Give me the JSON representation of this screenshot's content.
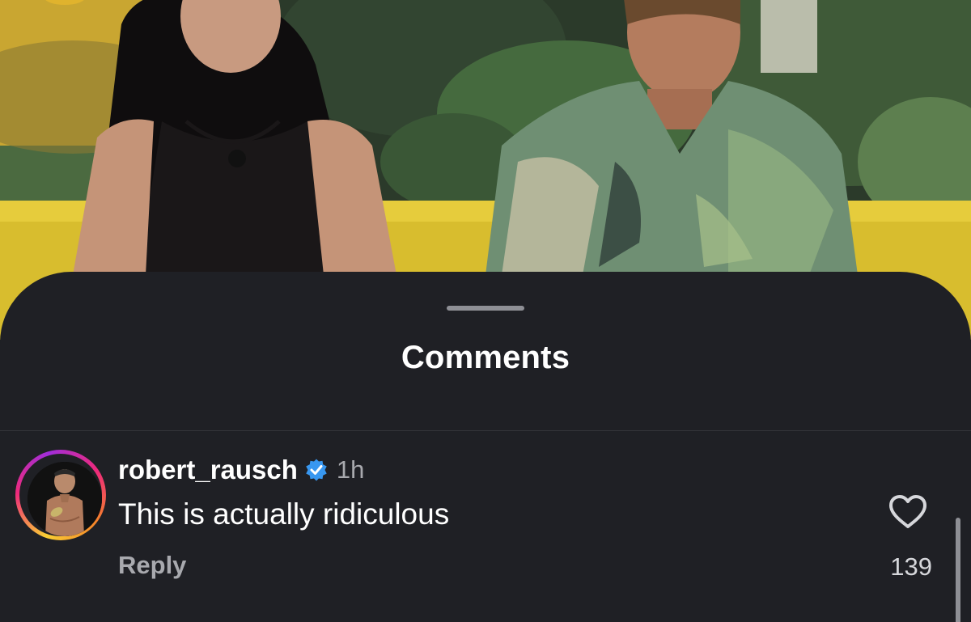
{
  "sheet": {
    "title": "Comments"
  },
  "comments": [
    {
      "username": "robert_rausch",
      "verified": true,
      "time": "1h",
      "text": "This is actually ridiculous",
      "reply_label": "Reply",
      "likes": "139"
    }
  ],
  "colors": {
    "sheet_background": "#1f2025",
    "verified_badge": "#3897f0",
    "secondary_text": "#a8a9ae"
  },
  "icons": {
    "verified": "verified-badge-icon",
    "like": "heart-outline-icon"
  }
}
